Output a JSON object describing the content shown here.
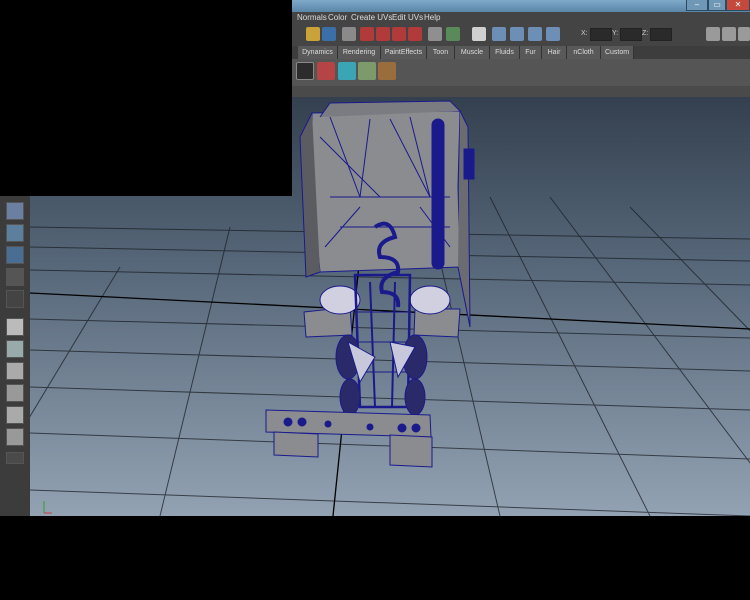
{
  "window": {
    "minimize_glyph": "–",
    "restore_glyph": "▭",
    "close_glyph": "✕"
  },
  "menubar": {
    "items": [
      "Normals",
      "Color",
      "Create UVs",
      "Edit UVs",
      "Help"
    ]
  },
  "statusline": {
    "field_labels": [
      "X:",
      "Y:",
      "Z:"
    ]
  },
  "shelf": {
    "tabs": [
      "Dynamics",
      "Rendering",
      "PaintEffects",
      "Toon",
      "Muscle",
      "Fluids",
      "Fur",
      "Hair",
      "nCloth",
      "Custom"
    ]
  },
  "viewport": {
    "background_top": "#34404f",
    "background_bottom": "#93a2b3",
    "grid_color": "#1a1f26",
    "axis_color": "#000000",
    "wireframe_color": "#1a1a8c",
    "mesh_fill_color": "#8a8c90"
  },
  "overlay": {
    "color": "#000000"
  }
}
